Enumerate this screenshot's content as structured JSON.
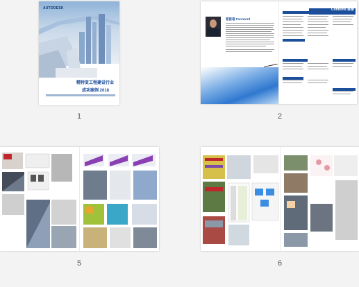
{
  "pages": [
    {
      "number": "1",
      "cover": {
        "logo": "AUTODESK",
        "title_line1": "精特变工程建设行业",
        "title_line2": "成功案例 2018"
      }
    },
    {
      "number": "2",
      "foreword_heading": "卷首语 Foreword",
      "contents_heading": "Contents 目录"
    },
    {
      "number": "5"
    },
    {
      "number": "6"
    }
  ],
  "colors": {
    "brand_blue": "#1b4f9c",
    "accent_red": "#c0272d"
  }
}
